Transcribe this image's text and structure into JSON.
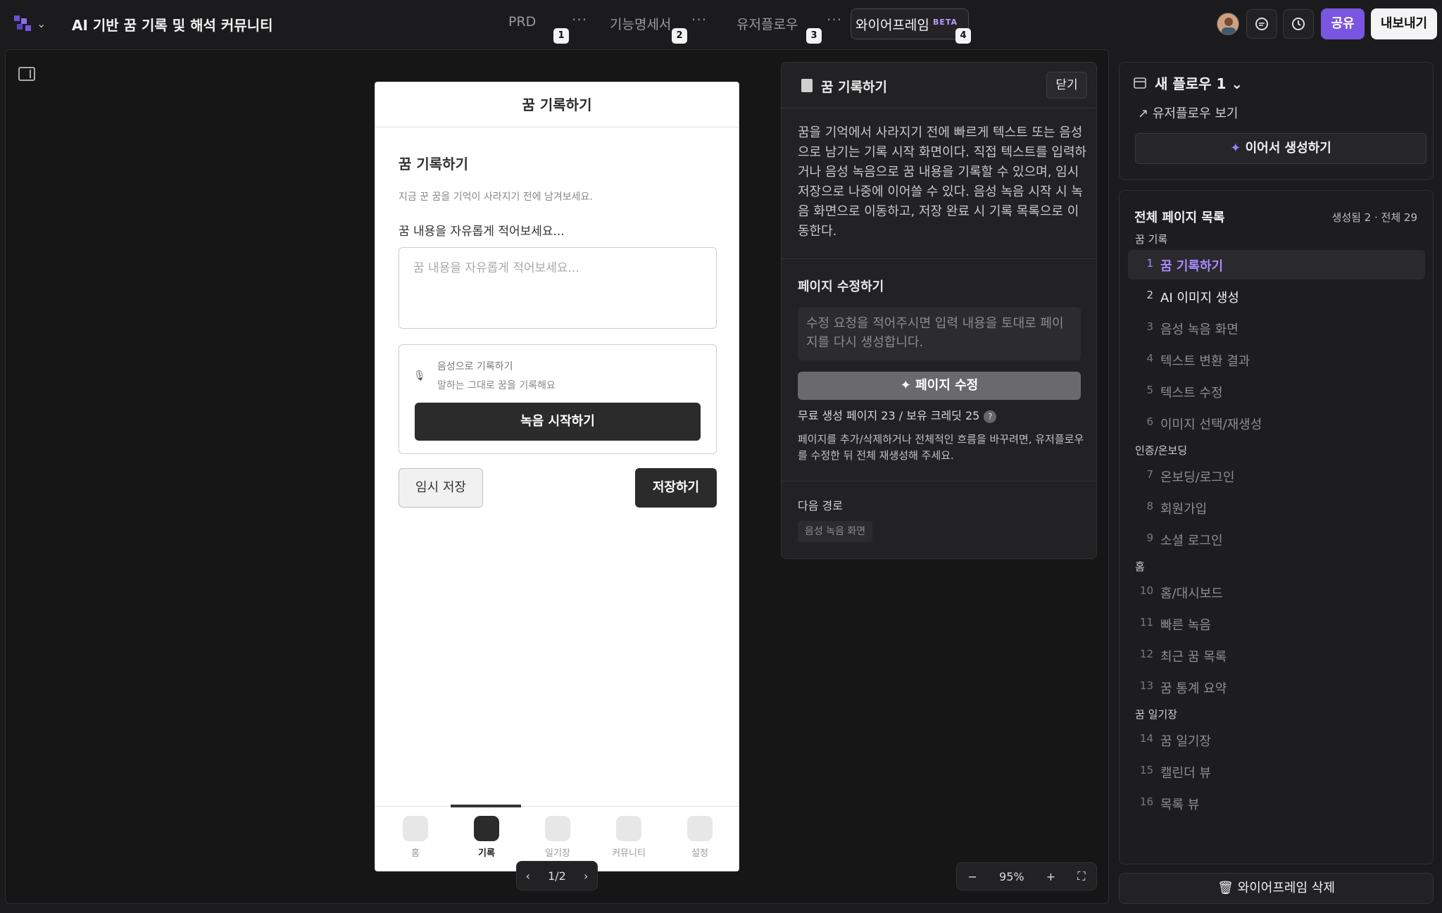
{
  "app": {
    "title": "AI 기반 꿈 기록 및 해석 커뮤니티"
  },
  "tabs": [
    {
      "label": "PRD",
      "num": "1",
      "more": "···"
    },
    {
      "label": "기능명세서",
      "num": "2",
      "more": "···"
    },
    {
      "label": "유저플로우",
      "num": "3",
      "more": "···"
    },
    {
      "label": "와이어프레임",
      "num": "4",
      "badge": "BETA"
    }
  ],
  "header_actions": {
    "share": "공유",
    "export": "내보내기"
  },
  "phone": {
    "header": "꿈 기록하기",
    "title": "꿈 기록하기",
    "subtitle": "지금 꾼 꿈을 기억이 사라지기 전에 남겨보세요.",
    "field_label": "꿈 내용을 자유롭게 적어보세요...",
    "textarea_placeholder": "꿈 내용을 자유롭게 적어보세요...",
    "voice_title": "음성으로 기록하기",
    "voice_sub": "말하는 그대로 꿈을 기록해요",
    "record_btn": "녹음 시작하기",
    "temp_save": "임시 저장",
    "save": "저장하기",
    "nav": [
      "홈",
      "기록",
      "일기장",
      "커뮤니티",
      "설정"
    ],
    "active_nav": "기록"
  },
  "pager": {
    "text": "1/2"
  },
  "zoom": {
    "value": "95%"
  },
  "desc": {
    "title": "꿈 기록하기",
    "close": "닫기",
    "body": "꿈을 기억에서 사라지기 전에 빠르게 텍스트 또는 음성으로 남기는 기록 시작 화면이다. 직접 텍스트를 입력하거나 음성 녹음으로 꿈 내용을 기록할 수 있으며, 임시 저장으로 나중에 이어쓸 수 있다. 음성 녹음 시작 시 녹음 화면으로 이동하고, 저장 완료 시 기록 목록으로 이동한다.",
    "edit_title": "페이지 수정하기",
    "edit_placeholder": "수정 요청을 적어주시면 입력 내용을 토대로 페이지를 다시 생성합니다.",
    "edit_btn": "페이지 수정",
    "quota": "무료 생성 페이지 23 / 보유 크레딧 25",
    "note": "페이지를 추가/삭제하거나 전체적인 흐름을 바꾸려면, 유저플로우를 수정한 뒤 전체 재생성해 주세요.",
    "next_title": "다음 경로",
    "next_chip": "음성 녹음 화면"
  },
  "flow": {
    "title": "새 플로우 1",
    "link": "유저플로우 보기",
    "continue": "이어서 생성하기"
  },
  "pagelist": {
    "title": "전체 페이지 목록",
    "count": "생성됨 2 · 전체 29",
    "groups": [
      {
        "name": "꿈 기록",
        "items": [
          {
            "num": "1",
            "label": "꿈 기록하기",
            "state": "sel"
          },
          {
            "num": "2",
            "label": "AI 이미지 생성",
            "state": "gen"
          },
          {
            "num": "3",
            "label": "음성 녹음 화면",
            "state": ""
          },
          {
            "num": "4",
            "label": "텍스트 변환 결과",
            "state": ""
          },
          {
            "num": "5",
            "label": "텍스트 수정",
            "state": ""
          },
          {
            "num": "6",
            "label": "이미지 선택/재생성",
            "state": ""
          }
        ]
      },
      {
        "name": "인증/온보딩",
        "items": [
          {
            "num": "7",
            "label": "온보딩/로그인",
            "state": ""
          },
          {
            "num": "8",
            "label": "회원가입",
            "state": ""
          },
          {
            "num": "9",
            "label": "소셜 로그인",
            "state": ""
          }
        ]
      },
      {
        "name": "홈",
        "items": [
          {
            "num": "10",
            "label": "홈/대시보드",
            "state": ""
          },
          {
            "num": "11",
            "label": "빠른 녹음",
            "state": ""
          },
          {
            "num": "12",
            "label": "최근 꿈 목록",
            "state": ""
          },
          {
            "num": "13",
            "label": "꿈 통계 요약",
            "state": ""
          }
        ]
      },
      {
        "name": "꿈 일기장",
        "items": [
          {
            "num": "14",
            "label": "꿈 일기장",
            "state": ""
          },
          {
            "num": "15",
            "label": "캘린더 뷰",
            "state": ""
          },
          {
            "num": "16",
            "label": "목록 뷰",
            "state": ""
          }
        ]
      }
    ]
  },
  "delete_btn": "와이어프레임 삭제",
  "colors": {
    "accent": "#7a55e0",
    "selected_text": "#a98bff"
  }
}
